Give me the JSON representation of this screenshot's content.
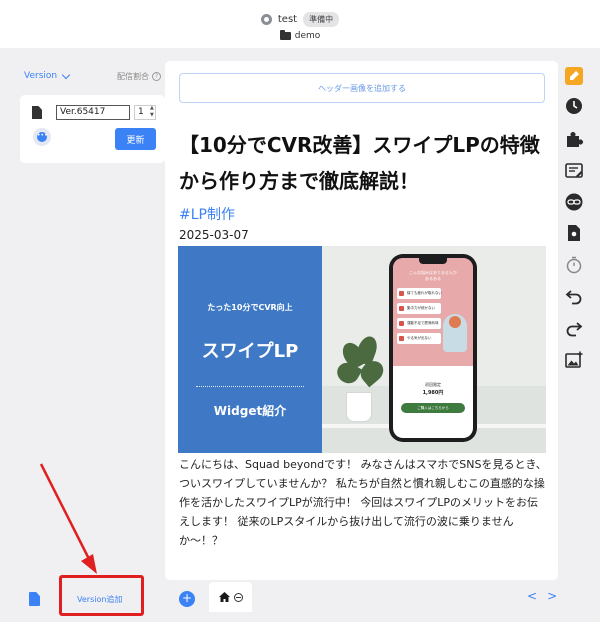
{
  "topbar": {
    "project_name": "test",
    "status": "準備中",
    "folder": "demo"
  },
  "left_panel": {
    "version_label": "Version",
    "distribution_ratio_label": "配信割合",
    "help": "?",
    "version_value": "Ver.65417",
    "ratio_value": "1",
    "more": "•••",
    "update_label": "更新"
  },
  "canvas": {
    "header_add_label": "ヘッダー画像を追加する",
    "title": "【10分でCVR改善】スワイプLPの特徴から作り方まで徹底解説！",
    "tag": "#LP制作",
    "date": "2025-03-07",
    "hero": {
      "subtitle": "たった10分でCVR向上",
      "main": "スワイプLP",
      "bottom": "Widget紹介",
      "phone": {
        "heading_line1": "こんな悩みはありませんか",
        "heading_line2": "あるある",
        "items": [
          "寝ても疲れが取れない",
          "集中力が続かない",
          "運動不足で肥満気味",
          "やる気が出ない"
        ],
        "limit": "初回限定",
        "price": "1,980円",
        "button": "ご購入はこちらから"
      }
    },
    "body": "こんにちは、Squad beyondです！ みなさんはスマホでSNSを見るとき、ついスワイプしていませんか？ 私たちが自然と慣れ親しむこの直感的な操作を活かしたスワイプLPが流行中！ 今回はスワイプLPのメリットをお伝えします！ 従来のLPスタイルから抜け出して流行の波に乗りませんか〜！？"
  },
  "bottom": {
    "version_add_label": "Version追加",
    "add_page": "+",
    "prev": "<",
    "next": ">"
  },
  "colors": {
    "accent": "#3b82f6",
    "annotation_red": "#e02020",
    "hero_blue": "#3f79c5",
    "toolbar_orange": "#f5a623"
  },
  "toolbar_icons": [
    "edit-icon",
    "history-icon",
    "puzzle-icon",
    "text-edit-icon",
    "link-icon",
    "settings-icon",
    "timer-icon",
    "undo-icon",
    "redo-icon",
    "image-icon"
  ]
}
